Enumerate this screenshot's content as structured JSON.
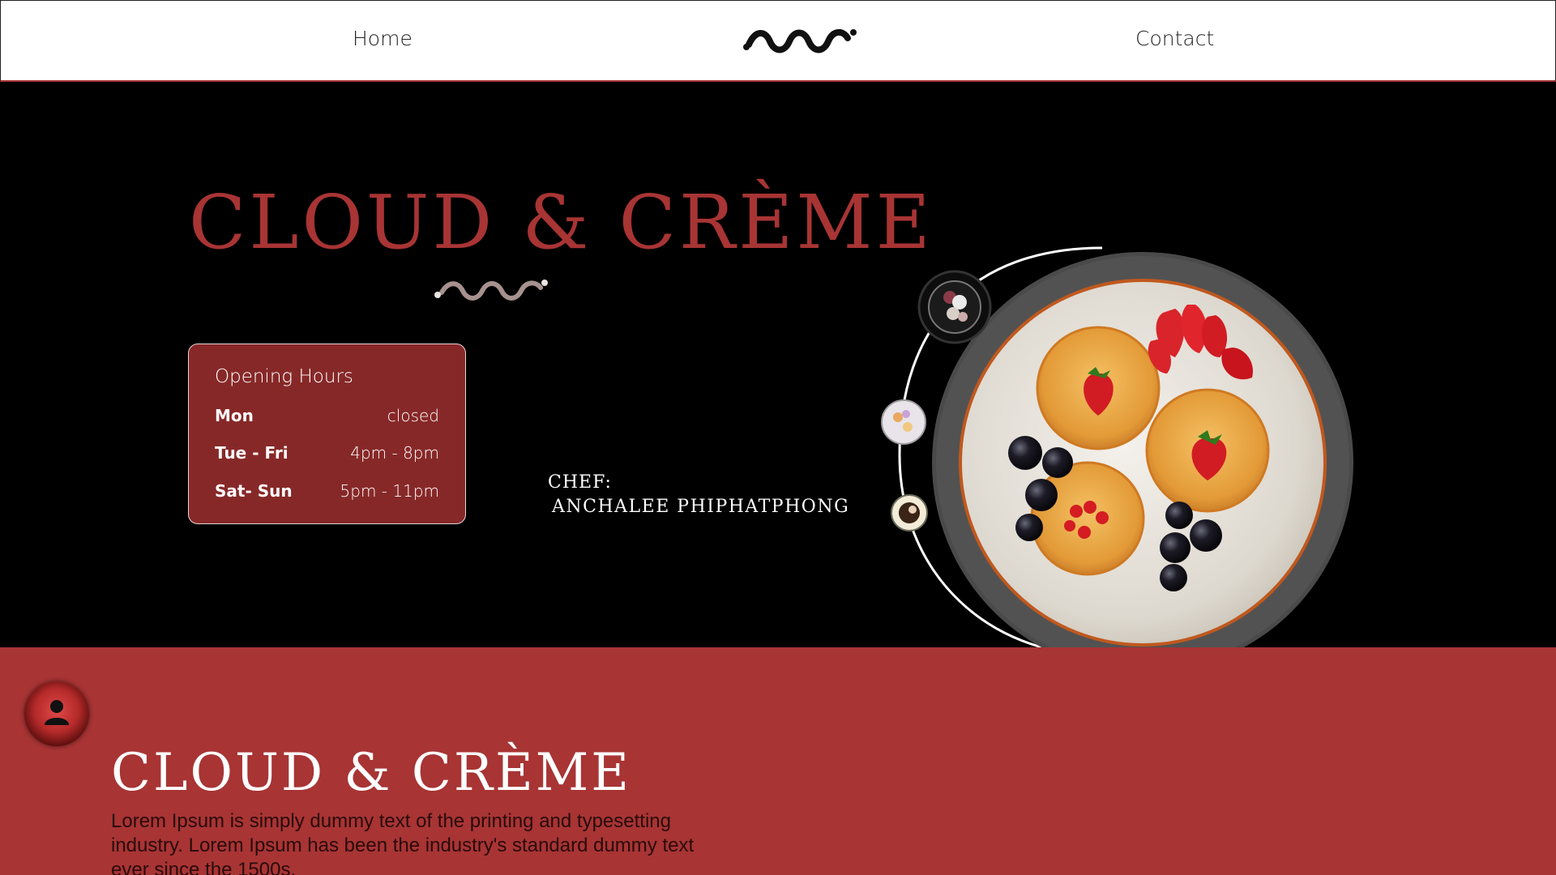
{
  "nav": {
    "home_label": "Home",
    "contact_label": "Contact",
    "logo_icon": "wave-logo-icon"
  },
  "hero": {
    "title": "CLOUD & CRÈME",
    "hours": {
      "title": "Opening Hours",
      "rows": [
        {
          "day": "Mon",
          "time": "closed"
        },
        {
          "day": "Tue - Fri",
          "time": "4pm - 8pm"
        },
        {
          "day": "Sat- Sun",
          "time": "5pm - 11pm"
        }
      ]
    },
    "chef_label": "CHEF:",
    "chef_name": "ANCHALEE PHIPHATPHONG"
  },
  "about": {
    "title": "CLOUD & CRÈME",
    "text": "Lorem Ipsum is simply dummy text of the printing and typesetting industry. Lorem Ipsum has been the industry's standard dummy text ever since the 1500s."
  },
  "colors": {
    "accent": "#a83434",
    "card": "#872828",
    "background": "#000000",
    "header": "#ffffff"
  },
  "icons": {
    "profile": "user-icon",
    "wave": "wave-divider-icon"
  }
}
